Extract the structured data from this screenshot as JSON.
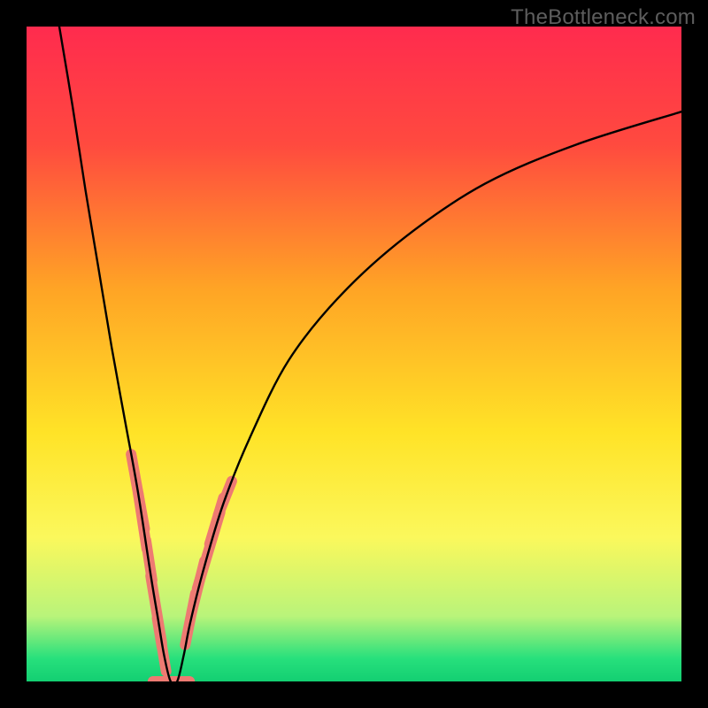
{
  "watermark": {
    "text": "TheBottleneck.com"
  },
  "chart_data": {
    "type": "line",
    "title": "",
    "xlabel": "",
    "ylabel": "",
    "xlim": [
      0,
      100
    ],
    "ylim": [
      0,
      100
    ],
    "background_gradient": {
      "stops": [
        {
          "pos": 0.0,
          "color": "#ff2b4e"
        },
        {
          "pos": 0.18,
          "color": "#ff4a3f"
        },
        {
          "pos": 0.4,
          "color": "#ffa425"
        },
        {
          "pos": 0.62,
          "color": "#ffe327"
        },
        {
          "pos": 0.78,
          "color": "#fbf85c"
        },
        {
          "pos": 0.9,
          "color": "#b9f47a"
        },
        {
          "pos": 0.965,
          "color": "#27e07c"
        },
        {
          "pos": 1.0,
          "color": "#13cf72"
        }
      ]
    },
    "curve": {
      "comment": "Bottleneck-percentage-style curve. y estimated as % bottleneck vs an x sweep; minimum ~x=22, y=0.",
      "x": [
        5,
        7,
        9,
        11,
        13,
        15,
        17,
        19,
        20,
        21,
        22,
        23,
        24,
        25,
        27,
        30,
        34,
        40,
        48,
        58,
        70,
        84,
        100
      ],
      "y": [
        100,
        88,
        75,
        63,
        51,
        40,
        29,
        16,
        10,
        4,
        0,
        0,
        4,
        9,
        17,
        27,
        37,
        49,
        59,
        68,
        76,
        82,
        87
      ]
    },
    "flat_segment": {
      "x0": 21.3,
      "x1": 23.0,
      "y": 0
    },
    "markers": {
      "comment": "Salmon rounded-rect markers clustered near the valley on both branches.",
      "color": "#ee7a72",
      "points": [
        {
          "x": 17.0,
          "y": 29.0,
          "len": 4.4
        },
        {
          "x": 17.7,
          "y": 24.5,
          "len": 3.4
        },
        {
          "x": 18.7,
          "y": 18.5,
          "len": 2.6
        },
        {
          "x": 19.8,
          "y": 11.0,
          "len": 4.0
        },
        {
          "x": 20.3,
          "y": 7.5,
          "len": 2.0
        },
        {
          "x": 20.9,
          "y": 4.0,
          "len": 2.2
        },
        {
          "x": 22.1,
          "y": 0.0,
          "len": 2.4
        },
        {
          "x": 25.0,
          "y": 9.5,
          "len": 3.2
        },
        {
          "x": 26.2,
          "y": 14.5,
          "len": 3.2
        },
        {
          "x": 27.8,
          "y": 20.0,
          "len": 4.6
        },
        {
          "x": 29.0,
          "y": 24.5,
          "len": 3.0
        },
        {
          "x": 30.3,
          "y": 28.0,
          "len": 2.4
        }
      ]
    },
    "flat_marker": {
      "x0": 21.0,
      "x1": 23.3,
      "y": 0,
      "color": "#ee7a72"
    }
  }
}
